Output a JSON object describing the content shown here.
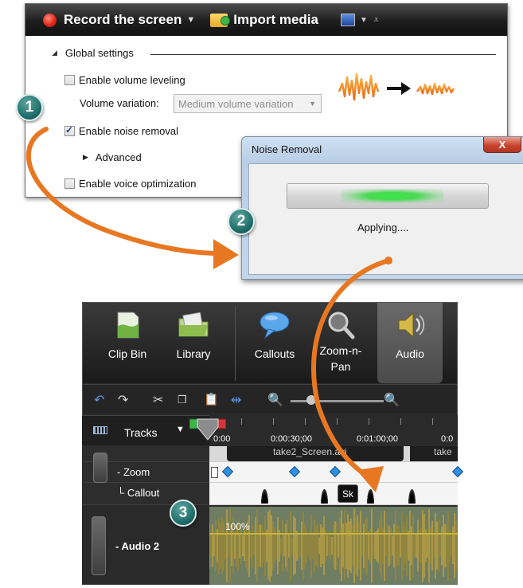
{
  "toolbar": {
    "record_label": "Record the screen",
    "record_caret": "▼",
    "import_label": "Import media",
    "more_caret": "▼",
    "filter_glyph": "⩡"
  },
  "settings": {
    "section_title": "Global settings",
    "volume_leveling": {
      "label": "Enable volume leveling",
      "checked": false
    },
    "volume_variation_label": "Volume variation:",
    "volume_variation_value": "Medium volume variation",
    "noise_removal": {
      "label": "Enable noise removal",
      "checked": true
    },
    "advanced_label": "Advanced",
    "voice_optimization": {
      "label": "Enable voice optimization",
      "checked": false
    }
  },
  "dialog": {
    "title": "Noise Removal",
    "close_glyph": "X",
    "status": "Applying....",
    "progress_color": "#3ee94a"
  },
  "tabs": [
    {
      "label": "Clip Bin",
      "icon": "clip-bin-icon"
    },
    {
      "label": "Library",
      "icon": "library-icon"
    },
    {
      "label": "Callouts",
      "icon": "callouts-icon"
    },
    {
      "label": "Zoom-n-\nPan",
      "icon": "zoom-n-pan-icon"
    },
    {
      "label": "Audio",
      "icon": "audio-icon"
    }
  ],
  "timeline": {
    "tracks_label": "Tracks",
    "ticks": [
      "0:00",
      "0:00:30;00",
      "0:01:00;00",
      "0:0"
    ],
    "video_clip_label": "take2_Screen.avi",
    "video_clip_label2": "take",
    "zoom_label": "Zoom",
    "callout_label": "Callout",
    "callout_clip": "Sk",
    "audio_label": "Audio 2",
    "audio_percent": "100%"
  },
  "steps": [
    "1",
    "2",
    "3"
  ],
  "colors": {
    "arrow": "#e87722",
    "badge": "#21706c"
  }
}
